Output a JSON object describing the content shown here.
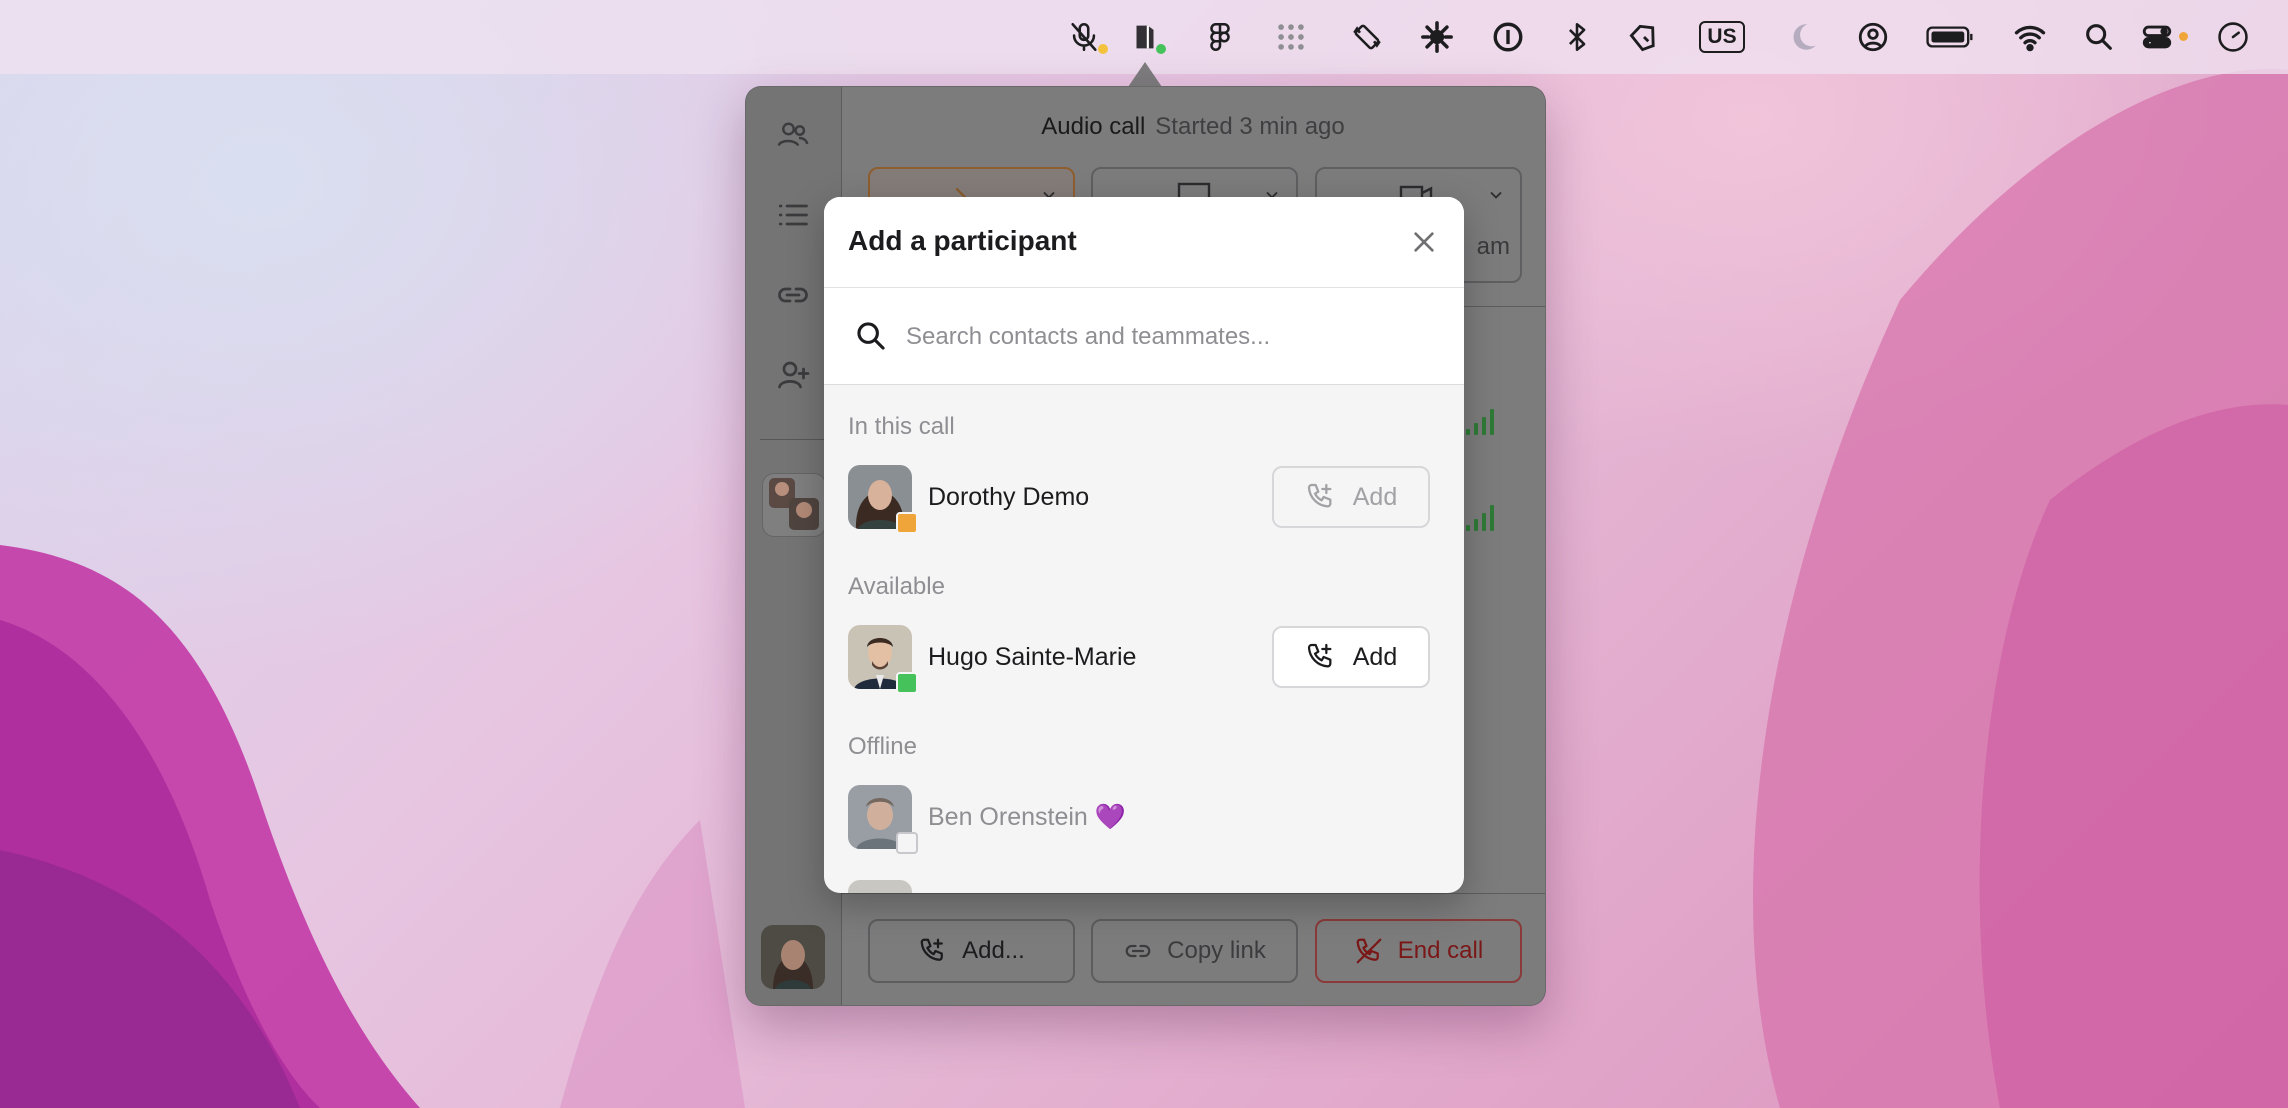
{
  "menubar": {
    "icons": [
      "mic-muted-icon",
      "tuple-app-icon",
      "figma-icon",
      "grid-dots-icon",
      "rotation-icon",
      "gear-burst-icon",
      "onepassword-icon",
      "bluetooth-icon",
      "pen-tool-icon",
      "input-source-icon",
      "moon-icon",
      "user-circle-icon",
      "battery-icon",
      "wifi-icon",
      "search-icon",
      "control-center-icon",
      "clock-icon"
    ],
    "input_source": "US"
  },
  "call": {
    "title": "Audio call",
    "status": "Started 3 min ago",
    "partial_label": "am",
    "sidebar_icons": [
      "people-icon",
      "list-icon",
      "link-icon",
      "add-person-icon"
    ],
    "bottom": {
      "add_label": "Add...",
      "copy_link_label": "Copy link",
      "end_call_label": "End call"
    }
  },
  "modal": {
    "title": "Add a participant",
    "search_placeholder": "Search contacts and teammates...",
    "sections": {
      "in_call": "In this call",
      "available": "Available",
      "offline": "Offline"
    },
    "people": {
      "dorothy": {
        "name": "Dorothy Demo",
        "status": "in-call",
        "add_label": "Add"
      },
      "hugo": {
        "name": "Hugo Sainte-Marie",
        "status": "available",
        "add_label": "Add"
      },
      "ben": {
        "name": "Ben Orenstein 💜",
        "status": "offline"
      }
    }
  },
  "colors": {
    "status_in_call": "#f0a53a",
    "status_available": "#45c25a",
    "end_call": "#8a3a3a",
    "mic_dot": "#f3c33e",
    "app_dot": "#45c25a"
  }
}
